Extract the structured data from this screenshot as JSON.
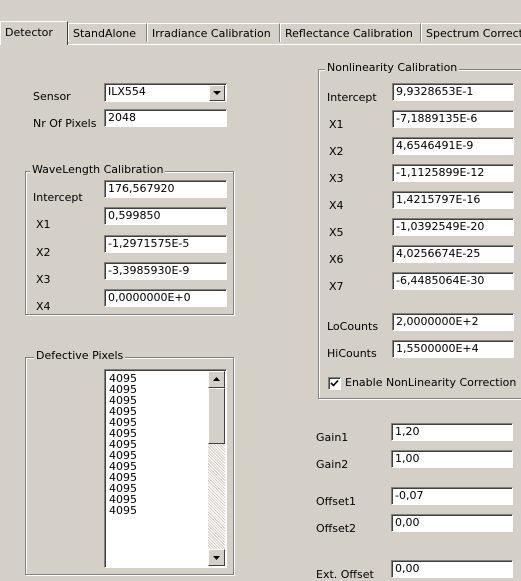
{
  "tabs": [
    {
      "label": "Detector",
      "active": true
    },
    {
      "label": "StandAlone"
    },
    {
      "label": "Irradiance Calibration"
    },
    {
      "label": "Reflectance Calibration"
    },
    {
      "label": "Spectrum Correcti"
    }
  ],
  "sensor": {
    "label": "Sensor",
    "value": "ILX554"
  },
  "pixels": {
    "label": "Nr Of Pixels",
    "value": "2048"
  },
  "wavelength": {
    "title": "WaveLength Calibration",
    "rows": [
      {
        "label": "Intercept",
        "value": "176,567920"
      },
      {
        "label": "X1",
        "value": "0,599850"
      },
      {
        "label": "X2",
        "value": "-1,2971575E-5"
      },
      {
        "label": "X3",
        "value": "-3,3985930E-9"
      },
      {
        "label": "X4",
        "value": "0,0000000E+0"
      }
    ]
  },
  "defective": {
    "title": "Defective Pixels",
    "items": [
      "4095",
      "4095",
      "4095",
      "4095",
      "4095",
      "4095",
      "4095",
      "4095",
      "4095",
      "4095",
      "4095",
      "4095",
      "4095"
    ]
  },
  "nonlinearity": {
    "title": "Nonlinearity Calibration",
    "rows": [
      {
        "label": "Intercept",
        "value": "9,9328653E-1"
      },
      {
        "label": "X1",
        "value": "-7,1889135E-6"
      },
      {
        "label": "X2",
        "value": "4,6546491E-9"
      },
      {
        "label": "X3",
        "value": "-1,1125899E-12"
      },
      {
        "label": "X4",
        "value": "1,4215797E-16"
      },
      {
        "label": "X5",
        "value": "-1,0392549E-20"
      },
      {
        "label": "X6",
        "value": "4,0256674E-25"
      },
      {
        "label": "X7",
        "value": "-6,4485064E-30"
      }
    ],
    "locounts": {
      "label": "LoCounts",
      "value": "2,0000000E+2"
    },
    "hicounts": {
      "label": "HiCounts",
      "value": "1,5500000E+4"
    },
    "enable": {
      "label": "Enable NonLinearity Correction",
      "checked": true
    }
  },
  "gain": [
    {
      "label": "Gain1",
      "value": "1,20"
    },
    {
      "label": "Gain2",
      "value": "1,00"
    }
  ],
  "offset": [
    {
      "label": "Offset1",
      "value": "-0,07"
    },
    {
      "label": "Offset2",
      "value": "0,00"
    }
  ],
  "ext_offset": {
    "label": "Ext. Offset",
    "value": "0,00"
  }
}
